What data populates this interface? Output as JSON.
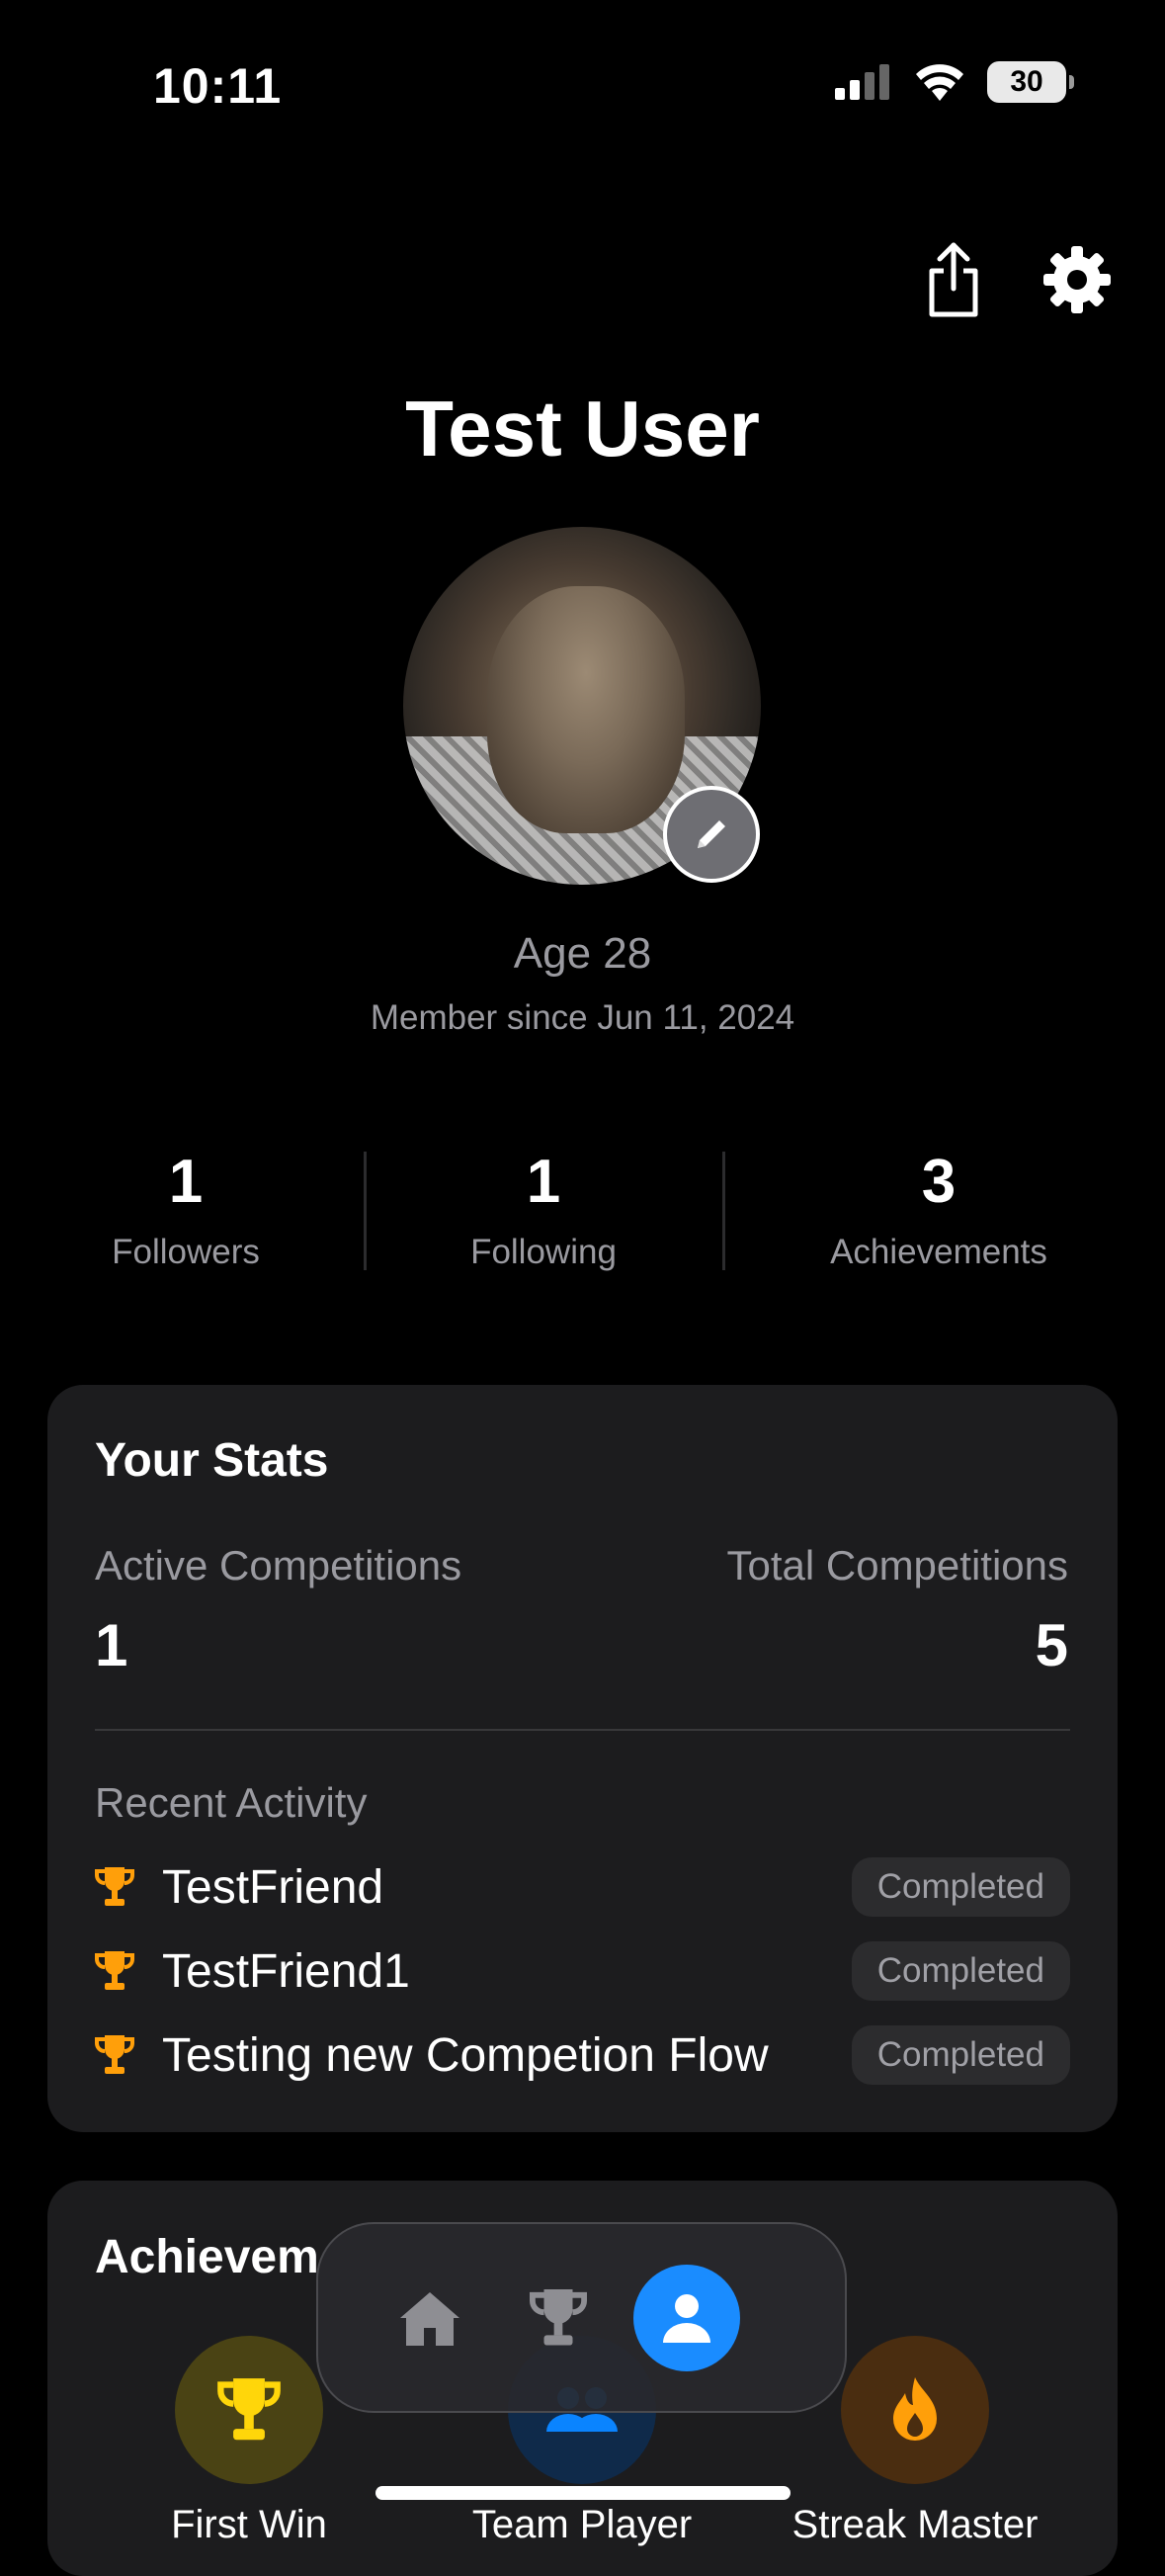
{
  "status_bar": {
    "time": "10:11",
    "battery": "30"
  },
  "profile": {
    "name": "Test User",
    "age": "Age 28",
    "member_since": "Member since Jun 11, 2024"
  },
  "counts": [
    {
      "value": "1",
      "label": "Followers"
    },
    {
      "value": "1",
      "label": "Following"
    },
    {
      "value": "3",
      "label": "Achievements"
    }
  ],
  "stats": {
    "title": "Your Stats",
    "active_label": "Active Competitions",
    "active_value": "1",
    "total_label": "Total Competitions",
    "total_value": "5",
    "recent_label": "Recent Activity",
    "activity": [
      {
        "name": "TestFriend",
        "status": "Completed"
      },
      {
        "name": "TestFriend1",
        "status": "Completed"
      },
      {
        "name": "Testing new Competion Flow",
        "status": "Completed"
      }
    ]
  },
  "achievements": {
    "title": "Achievem",
    "items": [
      {
        "label": "First Win",
        "icon": "trophy-icon",
        "color": "#ffd60a"
      },
      {
        "label": "Team Player",
        "icon": "people-icon",
        "color": "#0a84ff"
      },
      {
        "label": "Streak Master",
        "icon": "flame-icon",
        "color": "#ff9f0a"
      }
    ]
  },
  "tab_bar": {
    "items": [
      "home-icon",
      "trophy-icon",
      "person-icon"
    ],
    "active": "person-icon",
    "accent": "#1a8cff"
  }
}
